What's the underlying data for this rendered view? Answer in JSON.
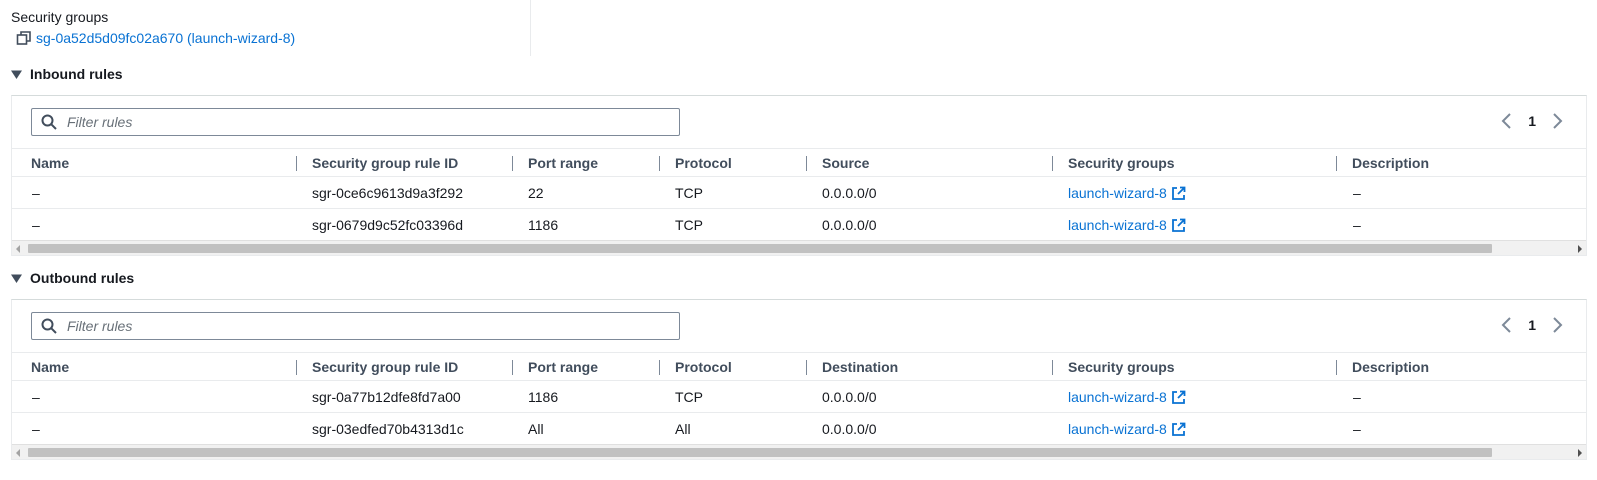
{
  "security_groups": {
    "label": "Security groups",
    "link": "sg-0a52d5d09fc02a670 (launch-wizard-8)"
  },
  "inbound": {
    "title": "Inbound rules",
    "search_placeholder": "Filter rules",
    "page": "1",
    "columns": [
      "Name",
      "Security group rule ID",
      "Port range",
      "Protocol",
      "Source",
      "Security groups",
      "Description"
    ],
    "rows": [
      {
        "name": "–",
        "rule_id": "sgr-0ce6c9613d9a3f292",
        "port_range": "22",
        "protocol": "TCP",
        "target": "0.0.0.0/0",
        "sg": "launch-wizard-8",
        "description": "–"
      },
      {
        "name": "–",
        "rule_id": "sgr-0679d9c52fc03396d",
        "port_range": "1186",
        "protocol": "TCP",
        "target": "0.0.0.0/0",
        "sg": "launch-wizard-8",
        "description": "–"
      }
    ]
  },
  "outbound": {
    "title": "Outbound rules",
    "search_placeholder": "Filter rules",
    "page": "1",
    "columns": [
      "Name",
      "Security group rule ID",
      "Port range",
      "Protocol",
      "Destination",
      "Security groups",
      "Description"
    ],
    "rows": [
      {
        "name": "–",
        "rule_id": "sgr-0a77b12dfe8fd7a00",
        "port_range": "1186",
        "protocol": "TCP",
        "target": "0.0.0.0/0",
        "sg": "launch-wizard-8",
        "description": "–"
      },
      {
        "name": "–",
        "rule_id": "sgr-03edfed70b4313d1c",
        "port_range": "All",
        "protocol": "All",
        "target": "0.0.0.0/0",
        "sg": "launch-wizard-8",
        "description": "–"
      }
    ]
  },
  "colors": {
    "link": "#0972d3",
    "text": "#16191f",
    "header_text": "#414d5c"
  }
}
